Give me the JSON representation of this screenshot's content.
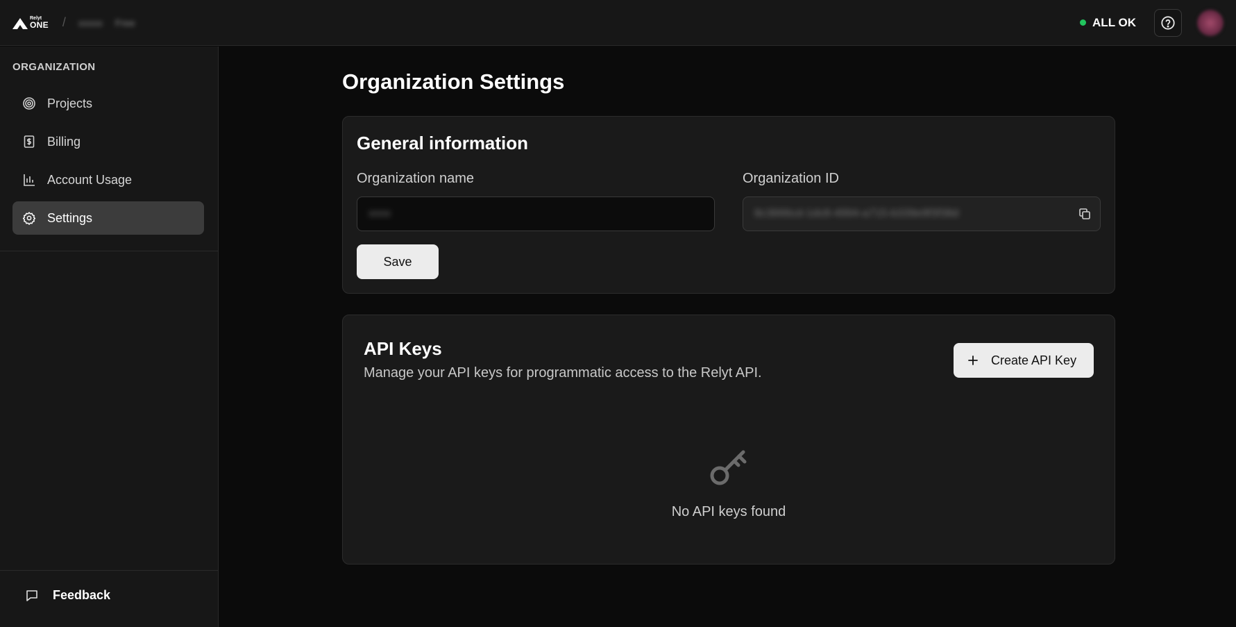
{
  "brand": {
    "small": "Relyt",
    "big": "ONE"
  },
  "breadcrumb": [
    "xxxxx",
    "Free"
  ],
  "status": {
    "label": "ALL OK",
    "color": "#22c55e"
  },
  "sidebar": {
    "heading": "ORGANIZATION",
    "items": [
      {
        "label": "Projects",
        "icon": "target-icon",
        "active": false
      },
      {
        "label": "Billing",
        "icon": "dollar-receipt-icon",
        "active": false
      },
      {
        "label": "Account Usage",
        "icon": "bar-chart-icon",
        "active": false
      },
      {
        "label": "Settings",
        "icon": "gear-icon",
        "active": true
      }
    ],
    "feedback": "Feedback"
  },
  "main": {
    "title": "Organization Settings",
    "general": {
      "title": "General information",
      "org_name_label": "Organization name",
      "org_name_value": "xxxx",
      "org_id_label": "Organization ID",
      "org_id_value": "8c3666cd-1dc8-4994-a715-b339e9f3f38d",
      "save_label": "Save"
    },
    "api_keys": {
      "title": "API Keys",
      "description": "Manage your API keys for programmatic access to the Relyt API.",
      "create_label": "Create API Key",
      "empty_text": "No API keys found"
    }
  }
}
